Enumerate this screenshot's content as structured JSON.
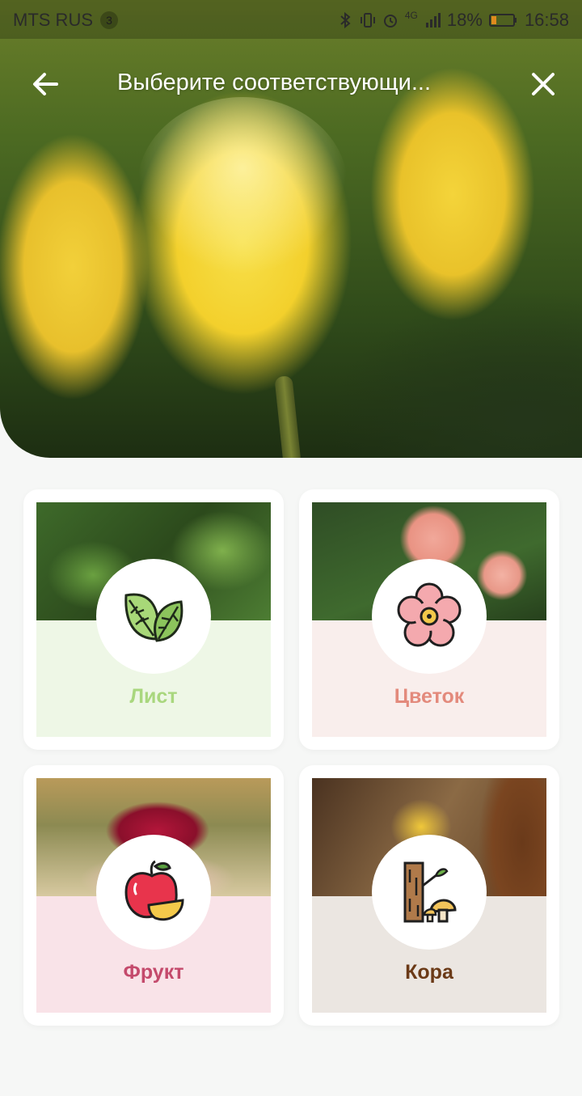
{
  "status_bar": {
    "carrier": "MTS RUS",
    "sim_badge": "3",
    "network": "4G",
    "battery": "18%",
    "time": "16:58"
  },
  "header": {
    "title": "Выберите соответствующи...",
    "back_icon": "arrow-left-icon",
    "close_icon": "close-icon"
  },
  "categories": [
    {
      "label": "Лист",
      "icon": "leaf-icon",
      "label_color": "#a9d77e",
      "panel_color": "#eef7e6"
    },
    {
      "label": "Цветок",
      "icon": "flower-icon",
      "label_color": "#e38a7c",
      "panel_color": "#f9eeec"
    },
    {
      "label": "Фрукт",
      "icon": "fruit-icon",
      "label_color": "#c44a6c",
      "panel_color": "#f9e3e8"
    },
    {
      "label": "Кора",
      "icon": "bark-icon",
      "label_color": "#6b3a17",
      "panel_color": "#ebe6e1"
    }
  ]
}
